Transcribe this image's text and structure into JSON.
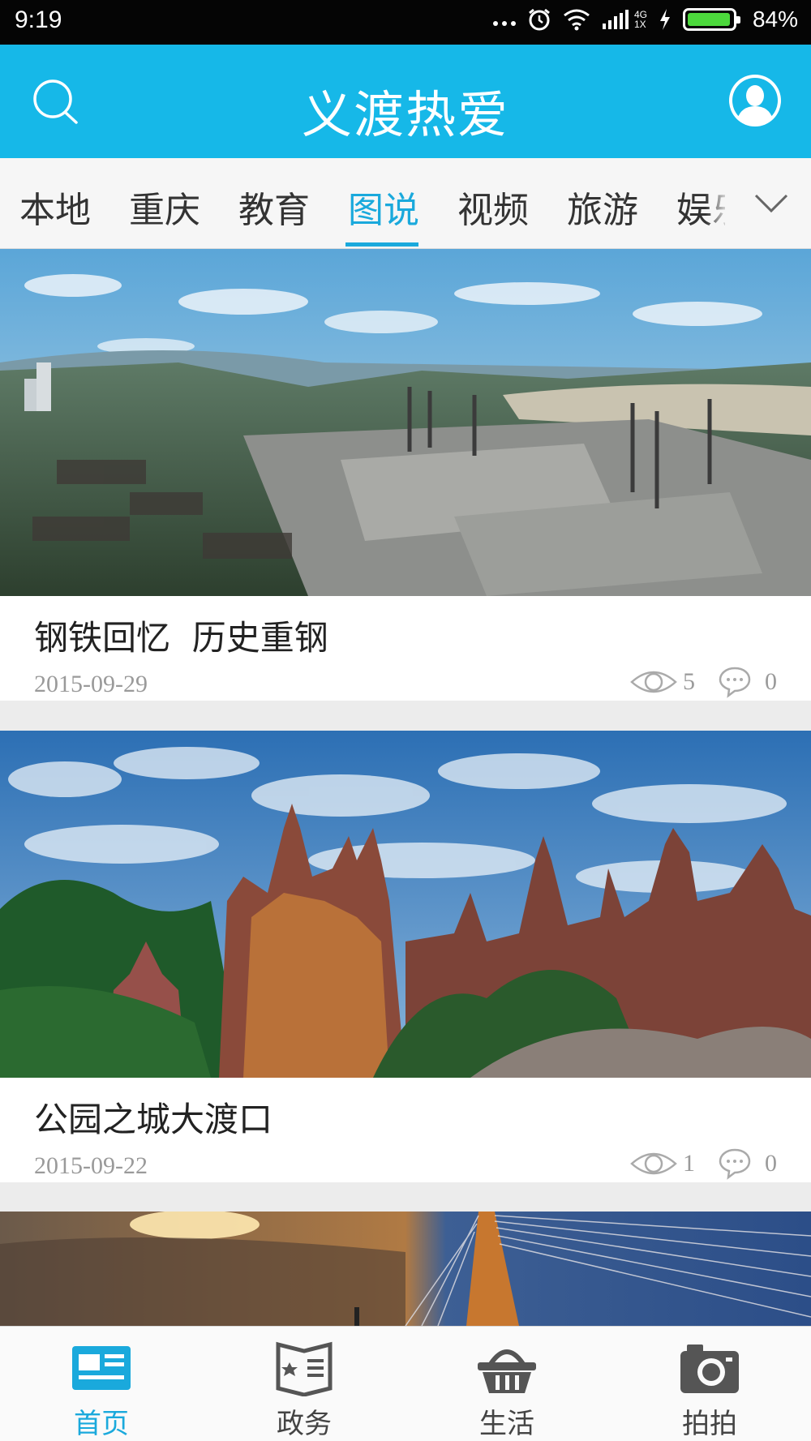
{
  "status_bar": {
    "time": "9:19",
    "network_label_top": "4G",
    "network_label_bottom": "1X",
    "battery_percent": "84%"
  },
  "header": {
    "title": "义渡热爱",
    "search_icon": "search-icon",
    "profile_icon": "user-avatar-icon",
    "background_color": "#16b8e8"
  },
  "tabs": {
    "items": [
      {
        "label": "本地"
      },
      {
        "label": "重庆"
      },
      {
        "label": "教育"
      },
      {
        "label": "图说"
      },
      {
        "label": "视频"
      },
      {
        "label": "旅游"
      },
      {
        "label": "娱乐"
      }
    ],
    "active_index": 3,
    "more_icon": "chevron-down-icon",
    "active_color": "#1aa9dc"
  },
  "feed": [
    {
      "headline": "钢铁回忆  历史重钢",
      "date": "2015-09-29",
      "views": "5",
      "comments": "0"
    },
    {
      "headline": "公园之城大渡口",
      "date": "2015-09-22",
      "views": "1",
      "comments": "0"
    }
  ],
  "bottom_nav": {
    "items": [
      {
        "label": "首页",
        "icon": "news-icon"
      },
      {
        "label": "政务",
        "icon": "government-book-icon"
      },
      {
        "label": "生活",
        "icon": "basket-icon"
      },
      {
        "label": "拍拍",
        "icon": "camera-icon"
      }
    ],
    "active_index": 0
  }
}
